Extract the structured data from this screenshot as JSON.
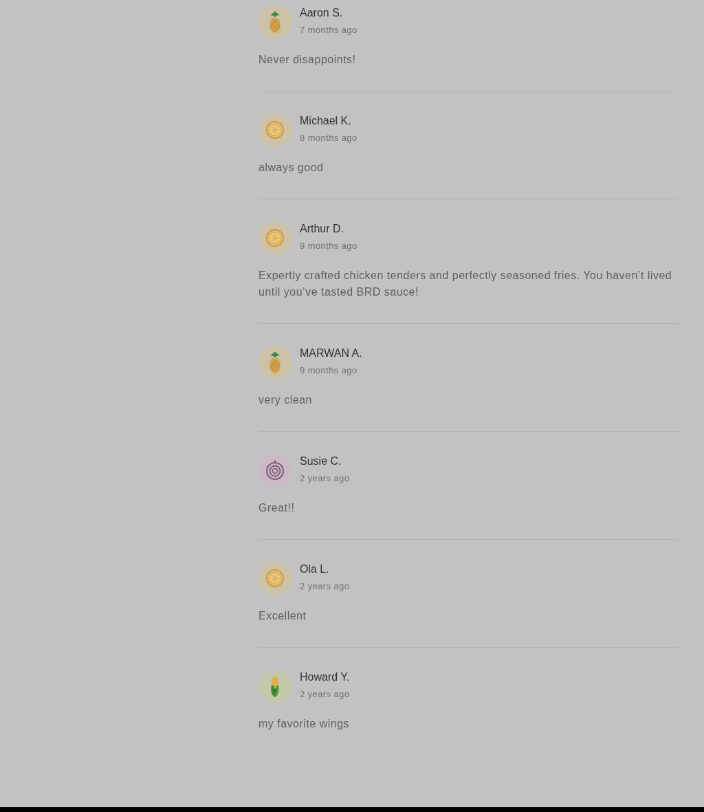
{
  "reviews": [
    {
      "name": "Aaron S.",
      "time": "7 months ago",
      "text": "Never disappoints!",
      "avatar": {
        "kind": "pineapple"
      }
    },
    {
      "name": "Michael K.",
      "time": "8 months ago",
      "text": "always good",
      "avatar": {
        "kind": "citrus"
      }
    },
    {
      "name": "Arthur D.",
      "time": "9 months ago",
      "text": "Expertly crafted chicken tenders and perfectly seasoned fries. You haven’t lived until you’ve tasted BRD sauce!",
      "avatar": {
        "kind": "citrus"
      }
    },
    {
      "name": "MARWAN A.",
      "time": "9 months ago",
      "text": "very clean",
      "avatar": {
        "kind": "pineapple"
      }
    },
    {
      "name": "Susie C.",
      "time": "2 years ago",
      "text": "Great!!",
      "avatar": {
        "kind": "onion"
      }
    },
    {
      "name": "Ola L.",
      "time": "2 years ago",
      "text": "Excellent",
      "avatar": {
        "kind": "citrus"
      }
    },
    {
      "name": "Howard Y.",
      "time": "2 years ago",
      "text": "my favorite wings",
      "avatar": {
        "kind": "corn"
      }
    }
  ]
}
